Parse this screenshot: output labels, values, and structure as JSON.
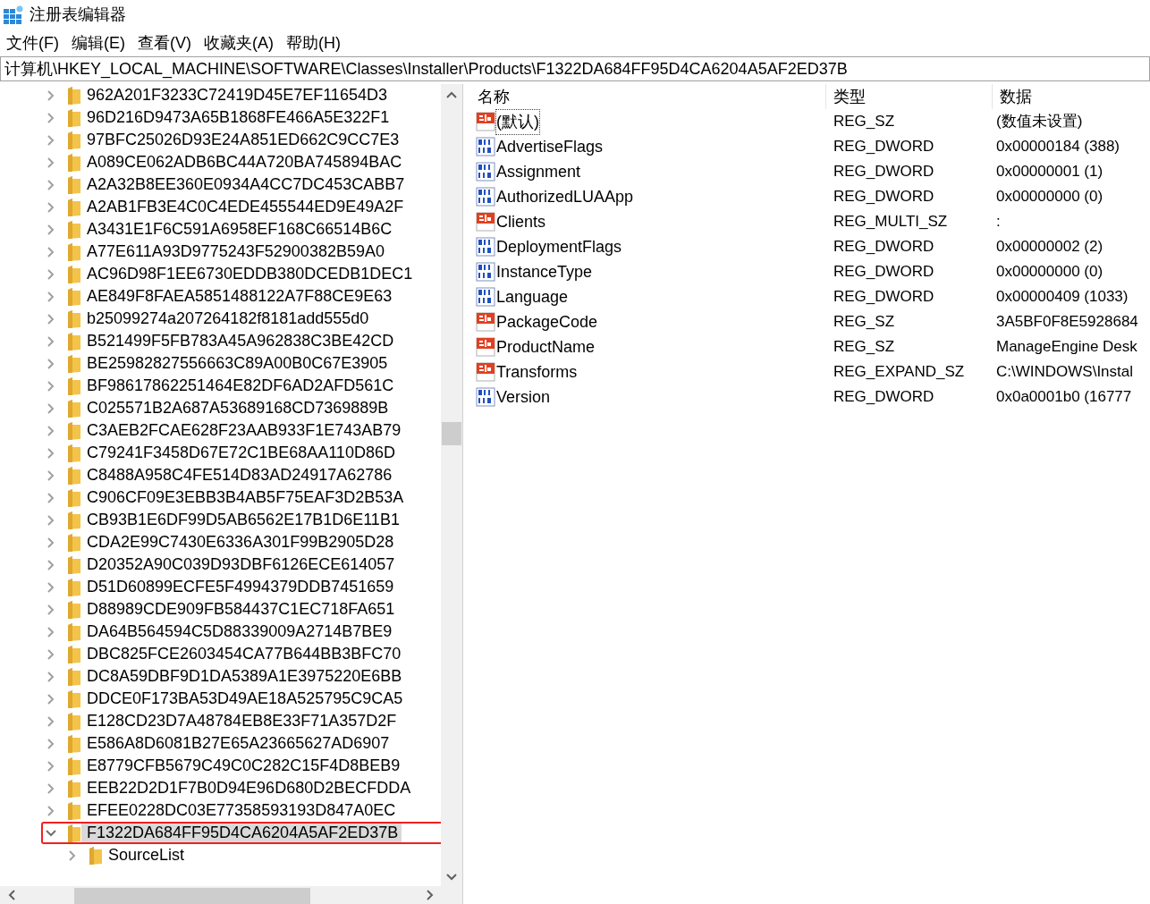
{
  "window": {
    "title": "注册表编辑器"
  },
  "menu": [
    "文件(F)",
    "编辑(E)",
    "查看(V)",
    "收藏夹(A)",
    "帮助(H)"
  ],
  "address": "计算机\\HKEY_LOCAL_MACHINE\\SOFTWARE\\Classes\\Installer\\Products\\F1322DA684FF95D4CA6204A5AF2ED37B",
  "tree": {
    "items": [
      {
        "label": "962A201F3233C72419D45E7EF11654D3",
        "expanded": false,
        "selected": false
      },
      {
        "label": "96D216D9473A65B1868FE466A5E322F1",
        "expanded": false,
        "selected": false
      },
      {
        "label": "97BFC25026D93E24A851ED662C9CC7E3",
        "expanded": false,
        "selected": false
      },
      {
        "label": "A089CE062ADB6BC44A720BA745894BAC",
        "expanded": false,
        "selected": false
      },
      {
        "label": "A2A32B8EE360E0934A4CC7DC453CABB7",
        "expanded": false,
        "selected": false
      },
      {
        "label": "A2AB1FB3E4C0C4EDE455544ED9E49A2F",
        "expanded": false,
        "selected": false
      },
      {
        "label": "A3431E1F6C591A6958EF168C66514B6C",
        "expanded": false,
        "selected": false
      },
      {
        "label": "A77E611A93D9775243F52900382B59A0",
        "expanded": false,
        "selected": false
      },
      {
        "label": "AC96D98F1EE6730EDDB380DCEDB1DEC1",
        "expanded": false,
        "selected": false
      },
      {
        "label": "AE849F8FAEA5851488122A7F88CE9E63",
        "expanded": false,
        "selected": false
      },
      {
        "label": "b25099274a207264182f8181add555d0",
        "expanded": false,
        "selected": false
      },
      {
        "label": "B521499F5FB783A45A962838C3BE42CD",
        "expanded": false,
        "selected": false
      },
      {
        "label": "BE25982827556663C89A00B0C67E3905",
        "expanded": false,
        "selected": false
      },
      {
        "label": "BF98617862251464E82DF6AD2AFD561C",
        "expanded": false,
        "selected": false
      },
      {
        "label": "C025571B2A687A53689168CD7369889B",
        "expanded": false,
        "selected": false
      },
      {
        "label": "C3AEB2FCAE628F23AAB933F1E743AB79",
        "expanded": false,
        "selected": false
      },
      {
        "label": "C79241F3458D67E72C1BE68AA110D86D",
        "expanded": false,
        "selected": false
      },
      {
        "label": "C8488A958C4FE514D83AD24917A62786",
        "expanded": false,
        "selected": false
      },
      {
        "label": "C906CF09E3EBB3B4AB5F75EAF3D2B53A",
        "expanded": false,
        "selected": false
      },
      {
        "label": "CB93B1E6DF99D5AB6562E17B1D6E11B1",
        "expanded": false,
        "selected": false
      },
      {
        "label": "CDA2E99C7430E6336A301F99B2905D28",
        "expanded": false,
        "selected": false
      },
      {
        "label": "D20352A90C039D93DBF6126ECE614057",
        "expanded": false,
        "selected": false
      },
      {
        "label": "D51D60899ECFE5F4994379DDB7451659",
        "expanded": false,
        "selected": false
      },
      {
        "label": "D88989CDE909FB584437C1EC718FA651",
        "expanded": false,
        "selected": false
      },
      {
        "label": "DA64B564594C5D88339009A2714B7BE9",
        "expanded": false,
        "selected": false
      },
      {
        "label": "DBC825FCE2603454CA77B644BB3BFC70",
        "expanded": false,
        "selected": false
      },
      {
        "label": "DC8A59DBF9D1DA5389A1E3975220E6BB",
        "expanded": false,
        "selected": false
      },
      {
        "label": "DDCE0F173BA53D49AE18A525795C9CA5",
        "expanded": false,
        "selected": false
      },
      {
        "label": "E128CD23D7A48784EB8E33F71A357D2F",
        "expanded": false,
        "selected": false
      },
      {
        "label": "E586A8D6081B27E65A23665627AD6907",
        "expanded": false,
        "selected": false
      },
      {
        "label": "E8779CFB5679C49C0C282C15F4D8BEB9",
        "expanded": false,
        "selected": false
      },
      {
        "label": "EEB22D2D1F7B0D94E96D680D2BECFDDA",
        "expanded": false,
        "selected": false
      },
      {
        "label": "EFEE0228DC03E77358593193D847A0EC",
        "expanded": false,
        "selected": false
      },
      {
        "label": "F1322DA684FF95D4CA6204A5AF2ED37B",
        "expanded": true,
        "selected": true,
        "children": [
          {
            "label": "SourceList",
            "expanded": false,
            "selected": false
          }
        ]
      }
    ]
  },
  "values": {
    "columns": [
      "名称",
      "类型",
      "数据"
    ],
    "rows": [
      {
        "kind": "string",
        "name": "(默认)",
        "focused": true,
        "type": "REG_SZ",
        "data": "(数值未设置)"
      },
      {
        "kind": "binary",
        "name": "AdvertiseFlags",
        "focused": false,
        "type": "REG_DWORD",
        "data": "0x00000184 (388)"
      },
      {
        "kind": "binary",
        "name": "Assignment",
        "focused": false,
        "type": "REG_DWORD",
        "data": "0x00000001 (1)"
      },
      {
        "kind": "binary",
        "name": "AuthorizedLUAApp",
        "focused": false,
        "type": "REG_DWORD",
        "data": "0x00000000 (0)"
      },
      {
        "kind": "string",
        "name": "Clients",
        "focused": false,
        "type": "REG_MULTI_SZ",
        "data": ":"
      },
      {
        "kind": "binary",
        "name": "DeploymentFlags",
        "focused": false,
        "type": "REG_DWORD",
        "data": "0x00000002 (2)"
      },
      {
        "kind": "binary",
        "name": "InstanceType",
        "focused": false,
        "type": "REG_DWORD",
        "data": "0x00000000 (0)"
      },
      {
        "kind": "binary",
        "name": "Language",
        "focused": false,
        "type": "REG_DWORD",
        "data": "0x00000409 (1033)"
      },
      {
        "kind": "string",
        "name": "PackageCode",
        "focused": false,
        "type": "REG_SZ",
        "data": "3A5BF0F8E5928684"
      },
      {
        "kind": "string",
        "name": "ProductName",
        "focused": false,
        "type": "REG_SZ",
        "data": "ManageEngine Desk"
      },
      {
        "kind": "string",
        "name": "Transforms",
        "focused": false,
        "type": "REG_EXPAND_SZ",
        "data": "C:\\WINDOWS\\Instal"
      },
      {
        "kind": "binary",
        "name": "Version",
        "focused": false,
        "type": "REG_DWORD",
        "data": "0x0a0001b0 (16777"
      }
    ]
  }
}
